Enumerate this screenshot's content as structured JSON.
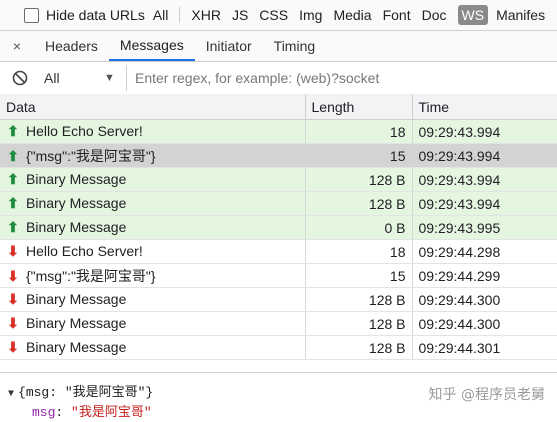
{
  "filter_bar": {
    "hide_data_urls": "Hide data URLs",
    "types": [
      "All",
      "XHR",
      "JS",
      "CSS",
      "Img",
      "Media",
      "Font",
      "Doc",
      "WS",
      "Manifes"
    ],
    "active_type": "WS"
  },
  "tabs": {
    "close": "×",
    "items": [
      "Headers",
      "Messages",
      "Initiator",
      "Timing"
    ],
    "active": "Messages"
  },
  "message_filter": {
    "selected": "All",
    "placeholder": "Enter regex, for example: (web)?socket"
  },
  "table": {
    "columns": [
      "Data",
      "Length",
      "Time"
    ],
    "rows": [
      {
        "dir": "sent",
        "data": "Hello Echo Server!",
        "length": "18",
        "time": "09:29:43.994"
      },
      {
        "dir": "sent",
        "data": "{\"msg\":\"我是阿宝哥\"}",
        "length": "15",
        "time": "09:29:43.994",
        "selected": true
      },
      {
        "dir": "sent",
        "data": "Binary Message",
        "length": "128 B",
        "time": "09:29:43.994"
      },
      {
        "dir": "sent",
        "data": "Binary Message",
        "length": "128 B",
        "time": "09:29:43.994"
      },
      {
        "dir": "sent",
        "data": "Binary Message",
        "length": "0 B",
        "time": "09:29:43.995"
      },
      {
        "dir": "received",
        "data": "Hello Echo Server!",
        "length": "18",
        "time": "09:29:44.298"
      },
      {
        "dir": "received",
        "data": "{\"msg\":\"我是阿宝哥\"}",
        "length": "15",
        "time": "09:29:44.299"
      },
      {
        "dir": "received",
        "data": "Binary Message",
        "length": "128 B",
        "time": "09:29:44.300"
      },
      {
        "dir": "received",
        "data": "Binary Message",
        "length": "128 B",
        "time": "09:29:44.300"
      },
      {
        "dir": "received",
        "data": "Binary Message",
        "length": "128 B",
        "time": "09:29:44.301"
      }
    ]
  },
  "preview": {
    "summary": "{msg: \"我是阿宝哥\"}",
    "key": "msg",
    "value": "\"我是阿宝哥\""
  },
  "watermark": "知乎 @程序员老舅",
  "colors": {
    "sent_row": "#e4f5e0",
    "selected_row": "#d3d3d3",
    "sent_arrow": "#1e8e3e",
    "received_arrow": "#d93025",
    "active_tab_underline": "#1a73e8"
  }
}
